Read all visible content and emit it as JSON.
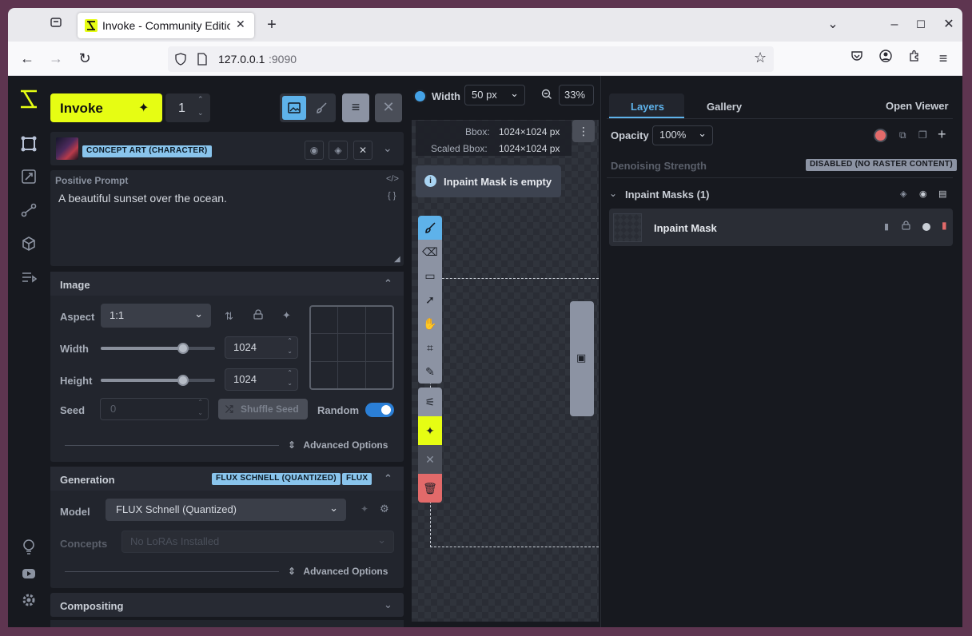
{
  "browser": {
    "tab_title": "Invoke - Community Editio",
    "url_host": "127.0.0.1",
    "url_port": ":9090"
  },
  "header": {
    "invoke_label": "Invoke",
    "queue_count": "1"
  },
  "style_preset": {
    "badge": "CONCEPT ART (CHARACTER)"
  },
  "prompt": {
    "label": "Positive Prompt",
    "value": "A beautiful sunset over the ocean."
  },
  "image_panel": {
    "title": "Image",
    "aspect_label": "Aspect",
    "aspect_value": "1:1",
    "width_label": "Width",
    "width_value": "1024",
    "width_fraction": 0.72,
    "height_label": "Height",
    "height_value": "1024",
    "height_fraction": 0.72,
    "seed_label": "Seed",
    "seed_value": "0",
    "shuffle_label": "Shuffle Seed",
    "random_label": "Random",
    "advanced_label": "Advanced Options"
  },
  "generation_panel": {
    "title": "Generation",
    "badge_model": "FLUX SCHNELL (QUANTIZED)",
    "badge_base": "FLUX",
    "model_label": "Model",
    "model_value": "FLUX Schnell (Quantized)",
    "concepts_label": "Concepts",
    "concepts_placeholder": "No LoRAs Installed",
    "advanced_label": "Advanced Options"
  },
  "compositing_panel": {
    "title": "Compositing"
  },
  "canvas": {
    "brush_width_label": "Width",
    "brush_width_value": "50 px",
    "zoom_value": "33%",
    "bbox_label": "Bbox:",
    "bbox_value": "1024×1024 px",
    "scaled_bbox_label": "Scaled Bbox:",
    "scaled_bbox_value": "1024×1024 px",
    "toast_message": "Inpaint Mask is empty"
  },
  "right_panel": {
    "tab_layers": "Layers",
    "tab_gallery": "Gallery",
    "open_viewer": "Open Viewer",
    "opacity_label": "Opacity",
    "opacity_value": "100%",
    "denoise_label": "Denoising Strength",
    "denoise_badge": "DISABLED (NO RASTER CONTENT)",
    "group_title": "Inpaint Masks (1)",
    "layer_name": "Inpaint Mask"
  },
  "colors": {
    "accent_yellow": "#e6fd13",
    "accent_blue": "#2b7fd6",
    "mask_red": "#e26a6a"
  }
}
